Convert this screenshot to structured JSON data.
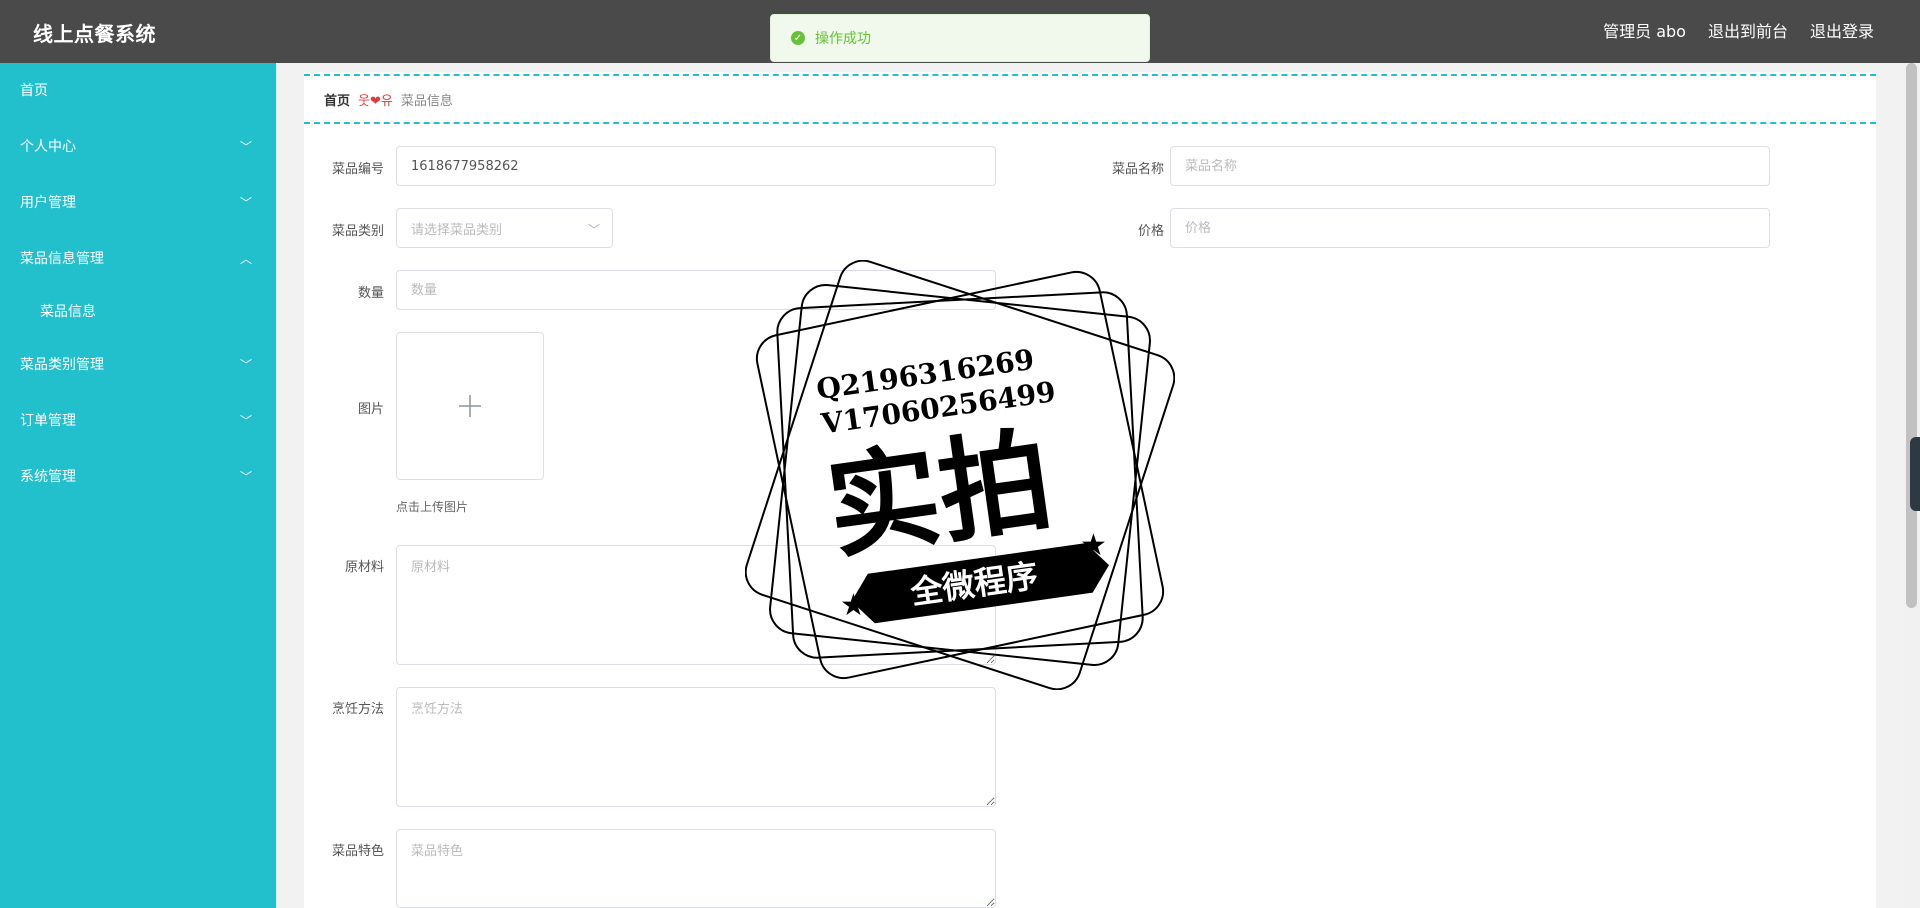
{
  "header": {
    "app_title": "线上点餐系统",
    "toast_message": "操作成功",
    "admin_label": "管理员 abo",
    "exit_to_front": "退出到前台",
    "logout": "退出登录"
  },
  "sidebar": {
    "items": [
      {
        "label": "首页"
      },
      {
        "label": "个人中心"
      },
      {
        "label": "用户管理"
      },
      {
        "label": "菜品信息管理"
      },
      {
        "label": "菜品信息"
      },
      {
        "label": "菜品类别管理"
      },
      {
        "label": "订单管理"
      },
      {
        "label": "系统管理"
      }
    ]
  },
  "breadcrumb": {
    "home": "首页",
    "separator": "웃❤유",
    "current": "菜品信息"
  },
  "form": {
    "dish_no": {
      "label": "菜品编号",
      "value": "1618677958262"
    },
    "dish_name": {
      "label": "菜品名称",
      "placeholder": "菜品名称"
    },
    "category": {
      "label": "菜品类别",
      "placeholder": "请选择菜品类别"
    },
    "price": {
      "label": "价格",
      "placeholder": "价格"
    },
    "quantity": {
      "label": "数量",
      "placeholder": "数量"
    },
    "image": {
      "label": "图片",
      "hint": "点击上传图片"
    },
    "ingredients": {
      "label": "原材料",
      "placeholder": "原材料"
    },
    "cooking": {
      "label": "烹饪方法",
      "placeholder": "烹饪方法"
    },
    "feature": {
      "label": "菜品特色",
      "placeholder": "菜品特色"
    }
  },
  "watermark": {
    "line1": "Q2196316269",
    "line2": "V17060256499",
    "big": "实拍",
    "banner": "全微程序"
  },
  "colors": {
    "header_bg": "#4a4a4a",
    "sidebar_bg": "#22c0cc",
    "accent": "#22c0cc",
    "toast_green": "#67c23a"
  }
}
